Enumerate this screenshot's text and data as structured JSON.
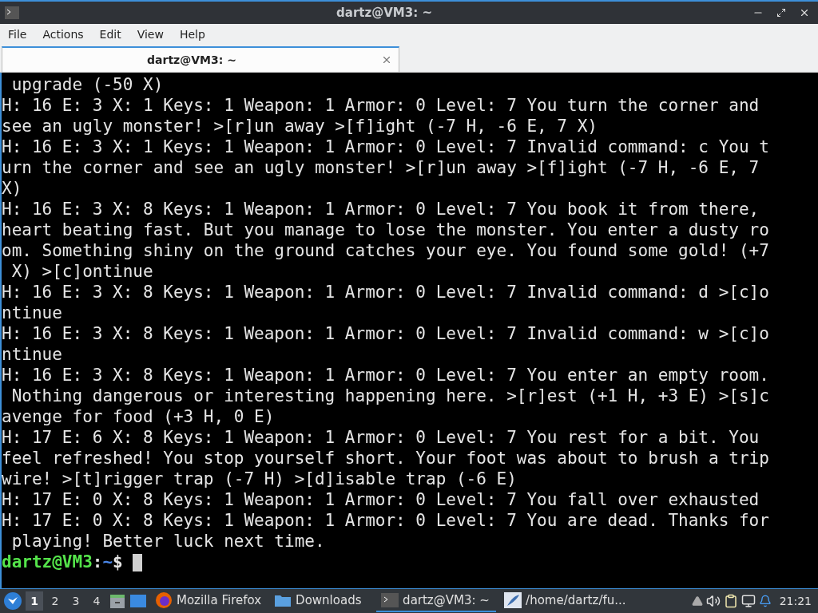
{
  "window": {
    "title": "dartz@VM3: ~"
  },
  "menu": [
    "File",
    "Actions",
    "Edit",
    "View",
    "Help"
  ],
  "tabs": [
    {
      "label": "dartz@VM3: ~",
      "selected": true
    }
  ],
  "terminal": {
    "lines": [
      " upgrade (-50 X)",
      "H: 16 E: 3 X: 1 Keys: 1 Weapon: 1 Armor: 0 Level: 7 You turn the corner and",
      "see an ugly monster! >[r]un away >[f]ight (-7 H, -6 E, 7 X)",
      "H: 16 E: 3 X: 1 Keys: 1 Weapon: 1 Armor: 0 Level: 7 Invalid command: c You t",
      "urn the corner and see an ugly monster! >[r]un away >[f]ight (-7 H, -6 E, 7",
      "X)",
      "H: 16 E: 3 X: 8 Keys: 1 Weapon: 1 Armor: 0 Level: 7 You book it from there,",
      "heart beating fast. But you manage to lose the monster. You enter a dusty ro",
      "om. Something shiny on the ground catches your eye. You found some gold! (+7",
      " X) >[c]ontinue",
      "H: 16 E: 3 X: 8 Keys: 1 Weapon: 1 Armor: 0 Level: 7 Invalid command: d >[c]o",
      "ntinue",
      "H: 16 E: 3 X: 8 Keys: 1 Weapon: 1 Armor: 0 Level: 7 Invalid command: w >[c]o",
      "ntinue",
      "H: 16 E: 3 X: 8 Keys: 1 Weapon: 1 Armor: 0 Level: 7 You enter an empty room.",
      " Nothing dangerous or interesting happening here. >[r]est (+1 H, +3 E) >[s]c",
      "avenge for food (+3 H, 0 E)",
      "H: 17 E: 6 X: 8 Keys: 1 Weapon: 1 Armor: 0 Level: 7 You rest for a bit. You",
      "feel refreshed! You stop yourself short. Your foot was about to brush a trip",
      "wire! >[t]rigger trap (-7 H) >[d]isable trap (-6 E)",
      "H: 17 E: 0 X: 8 Keys: 1 Weapon: 1 Armor: 0 Level: 7 You fall over exhausted",
      "H: 17 E: 0 X: 8 Keys: 1 Weapon: 1 Armor: 0 Level: 7 You are dead. Thanks for",
      " playing! Better luck next time."
    ],
    "prompt": {
      "user_host": "dartz@VM3",
      "separator": ":",
      "path": "~",
      "symbol": "$"
    }
  },
  "taskbar": {
    "workspaces": [
      {
        "label": "1",
        "selected": true
      },
      {
        "label": "2",
        "selected": false
      },
      {
        "label": "3",
        "selected": false
      },
      {
        "label": "4",
        "selected": false
      }
    ],
    "tasks": [
      {
        "kind": "browser",
        "label": "Mozilla Firefox",
        "selected": false
      },
      {
        "kind": "folder",
        "label": "Downloads",
        "selected": false
      },
      {
        "kind": "terminal",
        "label": "dartz@VM3: ~",
        "selected": true
      },
      {
        "kind": "editor",
        "label": "/home/dartz/fu...",
        "selected": false
      }
    ],
    "clock": "21:21"
  }
}
